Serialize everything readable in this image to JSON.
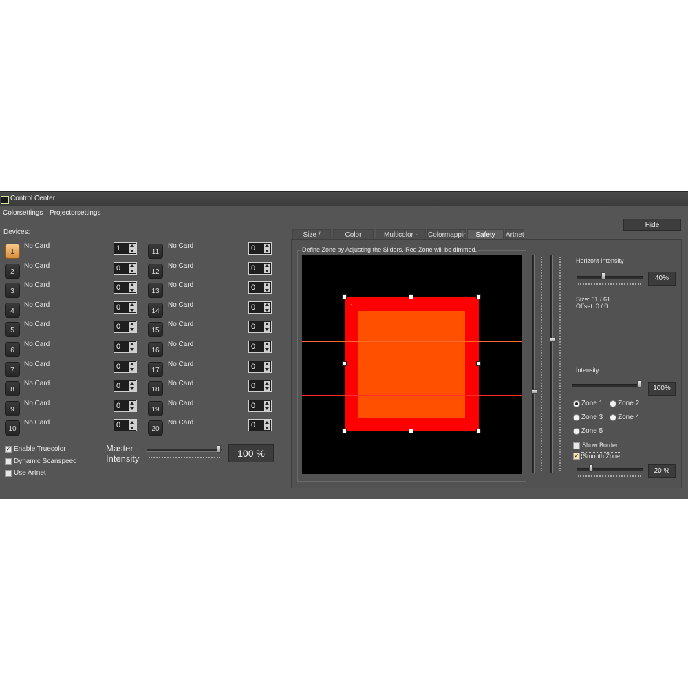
{
  "window": {
    "title": "Control Center"
  },
  "menu": {
    "items": [
      "Colorsettings",
      "Projectorsettings"
    ]
  },
  "devices_label": "Devices:",
  "devices": [
    {
      "num": "1",
      "card": "No Card",
      "value": "1"
    },
    {
      "num": "2",
      "card": "No Card",
      "value": "0"
    },
    {
      "num": "3",
      "card": "No Card",
      "value": "0"
    },
    {
      "num": "4",
      "card": "No Card",
      "value": "0"
    },
    {
      "num": "5",
      "card": "No Card",
      "value": "0"
    },
    {
      "num": "6",
      "card": "No Card",
      "value": "0"
    },
    {
      "num": "7",
      "card": "No Card",
      "value": "0"
    },
    {
      "num": "8",
      "card": "No Card",
      "value": "0"
    },
    {
      "num": "9",
      "card": "No Card",
      "value": "0"
    },
    {
      "num": "10",
      "card": "No Card",
      "value": "0"
    },
    {
      "num": "11",
      "card": "No Card",
      "value": "0"
    },
    {
      "num": "12",
      "card": "No Card",
      "value": "0"
    },
    {
      "num": "13",
      "card": "No Card",
      "value": "0"
    },
    {
      "num": "14",
      "card": "No Card",
      "value": "0"
    },
    {
      "num": "15",
      "card": "No Card",
      "value": "0"
    },
    {
      "num": "16",
      "card": "No Card",
      "value": "0"
    },
    {
      "num": "17",
      "card": "No Card",
      "value": "0"
    },
    {
      "num": "18",
      "card": "No Card",
      "value": "0"
    },
    {
      "num": "19",
      "card": "No Card",
      "value": "0"
    },
    {
      "num": "20",
      "card": "No Card",
      "value": "0"
    }
  ],
  "selected_device": "1",
  "options": {
    "enable_truecolor": {
      "label": "Enable Truecolor",
      "checked": true
    },
    "dynamic_scanspeed": {
      "label": "Dynamic Scanspeed",
      "checked": false
    },
    "use_artnet": {
      "label": "Use Artnet",
      "checked": false
    }
  },
  "master": {
    "label_line1": "Master -",
    "label_line2": "Intensity",
    "value_text": "100 %",
    "level": 1.0
  },
  "hide_label": "Hide",
  "tabs": [
    "Size / Offset",
    "Color Settings",
    "Multicolor - Setup",
    "Colormapping",
    "Safety Zone",
    "Artnet"
  ],
  "active_tab": "Safety Zone",
  "zone_group_title": "Define Zone by Adjusting the Sliders. Red Zone will be dimmed.",
  "preview": {
    "zone_number": "1"
  },
  "right": {
    "horizont_intensity": {
      "label": "Horizont Intensity",
      "value_text": "40%",
      "level": 0.4
    },
    "size_text": "Size:   61 / 61",
    "offset_text": "Offset: 0 / 0",
    "intensity": {
      "label": "Intensity",
      "value_text": "100%",
      "level": 1.0
    },
    "zones": [
      "Zone 1",
      "Zone 2",
      "Zone 3",
      "Zone 4",
      "Zone 5"
    ],
    "selected_zone": "Zone 1",
    "show_border": {
      "label": "Show Border",
      "checked": false
    },
    "smooth_zone": {
      "label": "Smooth Zone",
      "checked": true
    },
    "smooth": {
      "value_text": "20 %",
      "level": 0.2
    }
  },
  "colors": {
    "zone_red": "#ff0000",
    "zone_inner": "#ff5000",
    "active_device": "#e9a55a",
    "preview_bg": "#000000"
  }
}
